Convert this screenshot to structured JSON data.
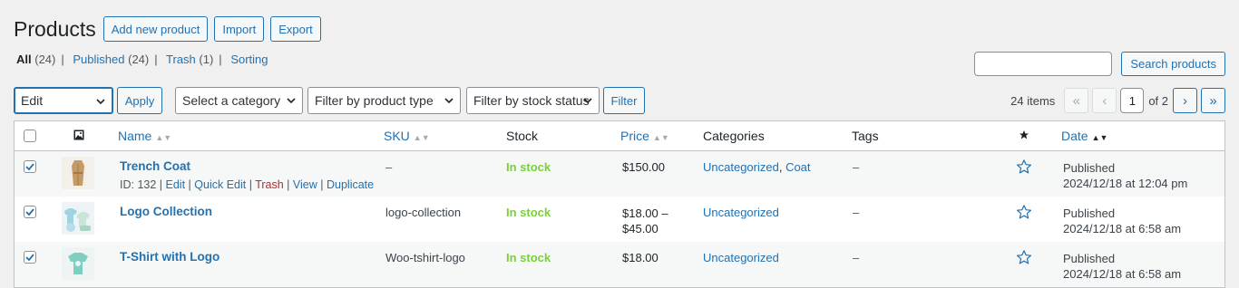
{
  "header": {
    "title": "Products",
    "buttons": {
      "add_new": "Add new product",
      "import": "Import",
      "export": "Export"
    }
  },
  "views": {
    "all": {
      "label": "All",
      "count": "(24)"
    },
    "published": {
      "label": "Published",
      "count": "(24)"
    },
    "trash": {
      "label": "Trash",
      "count": "(1)"
    },
    "sorting": {
      "label": "Sorting"
    }
  },
  "search": {
    "value": "",
    "button": "Search products"
  },
  "tablenav": {
    "bulk_action": "Edit",
    "apply": "Apply",
    "category": "Select a category",
    "product_type": "Filter by product type",
    "stock_status": "Filter by stock status",
    "filter": "Filter",
    "items": "24 items",
    "page": "1",
    "of": "of 2",
    "first": "«",
    "prev": "‹",
    "next": "›",
    "last": "»"
  },
  "columns": {
    "name": "Name",
    "sku": "SKU",
    "stock": "Stock",
    "price": "Price",
    "categories": "Categories",
    "tags": "Tags",
    "date": "Date",
    "sort_glyph": "▲▼",
    "date_sort_glyph": "▲▼"
  },
  "rows": [
    {
      "name": "Trench Coat",
      "actions": {
        "id": "ID: 132",
        "edit": "Edit",
        "quick_edit": "Quick Edit",
        "trash": "Trash",
        "view": "View",
        "duplicate": "Duplicate"
      },
      "sku": "–",
      "stock": "In stock",
      "price_line1": "$150.00",
      "price_line2": "",
      "cat1": "Uncategorized",
      "cat2": "Coat",
      "tags": "–",
      "status": "Published",
      "date": "2024/12/18 at 12:04 pm"
    },
    {
      "name": "Logo Collection",
      "sku": "logo-collection",
      "stock": "In stock",
      "price_line1": "$18.00 –",
      "price_line2": "$45.00",
      "cat1": "Uncategorized",
      "tags": "–",
      "status": "Published",
      "date": "2024/12/18 at 6:58 am"
    },
    {
      "name": "T-Shirt with Logo",
      "sku": "Woo-tshirt-logo",
      "stock": "In stock",
      "price_line1": "$18.00",
      "cat1": "Uncategorized",
      "tags": "–",
      "status": "Published",
      "date": "2024/12/18 at 6:58 am"
    }
  ],
  "colors": {
    "accent": "#2271b1",
    "in_stock": "#7ad03a",
    "trash": "#b32d2e"
  }
}
